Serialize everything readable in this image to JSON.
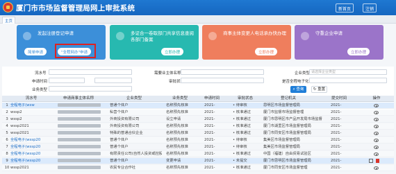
{
  "header": {
    "title": "厦门市市场监督管理局网上审批系统",
    "portal_btn": "新首页",
    "logout_btn": "注销"
  },
  "tabs": [
    {
      "label": "主页"
    }
  ],
  "cards": [
    {
      "title": "发起注册登记申请",
      "buttons": [
        "简单申请",
        "\"全程网办\"申请"
      ],
      "color": "#3c8fd9"
    },
    {
      "title": "多证合一卷取部门共享信息查阅 各部门备案",
      "buttons": [
        "立即办理"
      ],
      "color": "#27b9b0"
    },
    {
      "title": "商事主体变更人电话承办快办理",
      "buttons": [
        "立即办理"
      ],
      "color": "#ef7e5d"
    },
    {
      "title": "守重企业申请",
      "buttons": [
        "立即办理"
      ],
      "color": "#9b74c9"
    }
  ],
  "filters": {
    "serial_label": "流水号",
    "applicant_label": "需要业主体名称",
    "business_type_label": "企业类型",
    "business_type_placeholder": "请选择企业类型",
    "apply_time_label": "申请时间",
    "audit_status_label": "审批状态",
    "e_flag_label": "是否全程电子化",
    "biz_label": "业务类型",
    "query_btn": "查询",
    "reset_btn": "重置"
  },
  "table": {
    "columns": [
      "流水号",
      "申请商事主体名称",
      "企业类型",
      "业务类型",
      "申请时间",
      "审批状态",
      "登记机关",
      "提交时间",
      "操作"
    ],
    "rows": [
      {
        "no": "1",
        "serial": "全程电子(wsw",
        "type": "普通个体户",
        "biz": "名称预先核准",
        "time": "2021-",
        "status": "• 待审核",
        "org": "思明区市场监督管理局",
        "submit": "2021-",
        "sel": true
      },
      {
        "no": "2",
        "serial": "wssp2",
        "type": "私营个体户",
        "biz": "名称预先核准",
        "time": "2021-",
        "status": "• 核准通过",
        "org": "厦门市监督市场监督管理",
        "submit": "2021-"
      },
      {
        "no": "3",
        "serial": "wssp2",
        "type": "外商投资有限公司",
        "biz": "设立申请",
        "time": "2021-",
        "status": "• 核准通过",
        "org": "厦门市思明区市产品开发局市场监督",
        "submit": "2021-"
      },
      {
        "no": "4",
        "serial": "wssp2021",
        "type": "外商投资有限公司",
        "biz": "名称预先核准",
        "time": "2021-",
        "status": "• 核准通过",
        "org": "厦门市湖里区市场监督管理局",
        "submit": "2021-"
      },
      {
        "no": "5",
        "serial": "wssp2021",
        "type": "特殊的普通合伙企业",
        "biz": "名称预先核准",
        "time": "2021-",
        "status": "• 核准通过",
        "org": "厦门市同安区市场监督管理局",
        "submit": "2021-"
      },
      {
        "no": "6",
        "serial": "全程电子(wssp20",
        "type": "普通个体户",
        "biz": "名称预先核准",
        "time": "2021-",
        "status": "• 待审核",
        "org": "集美区市场监督管理局",
        "submit": "2021-"
      },
      {
        "no": "7",
        "serial": "全程电子(wssp20",
        "type": "普通个体户",
        "biz": "名称预先核准",
        "time": "2021-",
        "status": "• 待审核",
        "org": "集美区市场监督管理局",
        "submit": "2021-"
      },
      {
        "no": "8",
        "serial": "全程电子(wssp20",
        "type": "有限责任公司(自然人投资或控股)",
        "biz": "名称预先核准",
        "time": "2021-",
        "status": "• 核准通过",
        "org": "中国（福建）自由贸易试验区",
        "submit": "2021-"
      },
      {
        "no": "9",
        "serial": "全程电子(wssp20",
        "type": "普通个体户",
        "biz": "变更申请",
        "time": "2021-",
        "status": "• 未提交",
        "org": "厦门市思明区市场监督管理局",
        "submit": "2021-",
        "sel": true
      },
      {
        "no": "10",
        "serial": "wssp2021",
        "type": "农民专业合作社",
        "biz": "名称预先核准",
        "time": "2021-",
        "status": "• 核准通过",
        "org": "厦门市同安区市场监督管理",
        "submit": "2021-"
      }
    ]
  }
}
